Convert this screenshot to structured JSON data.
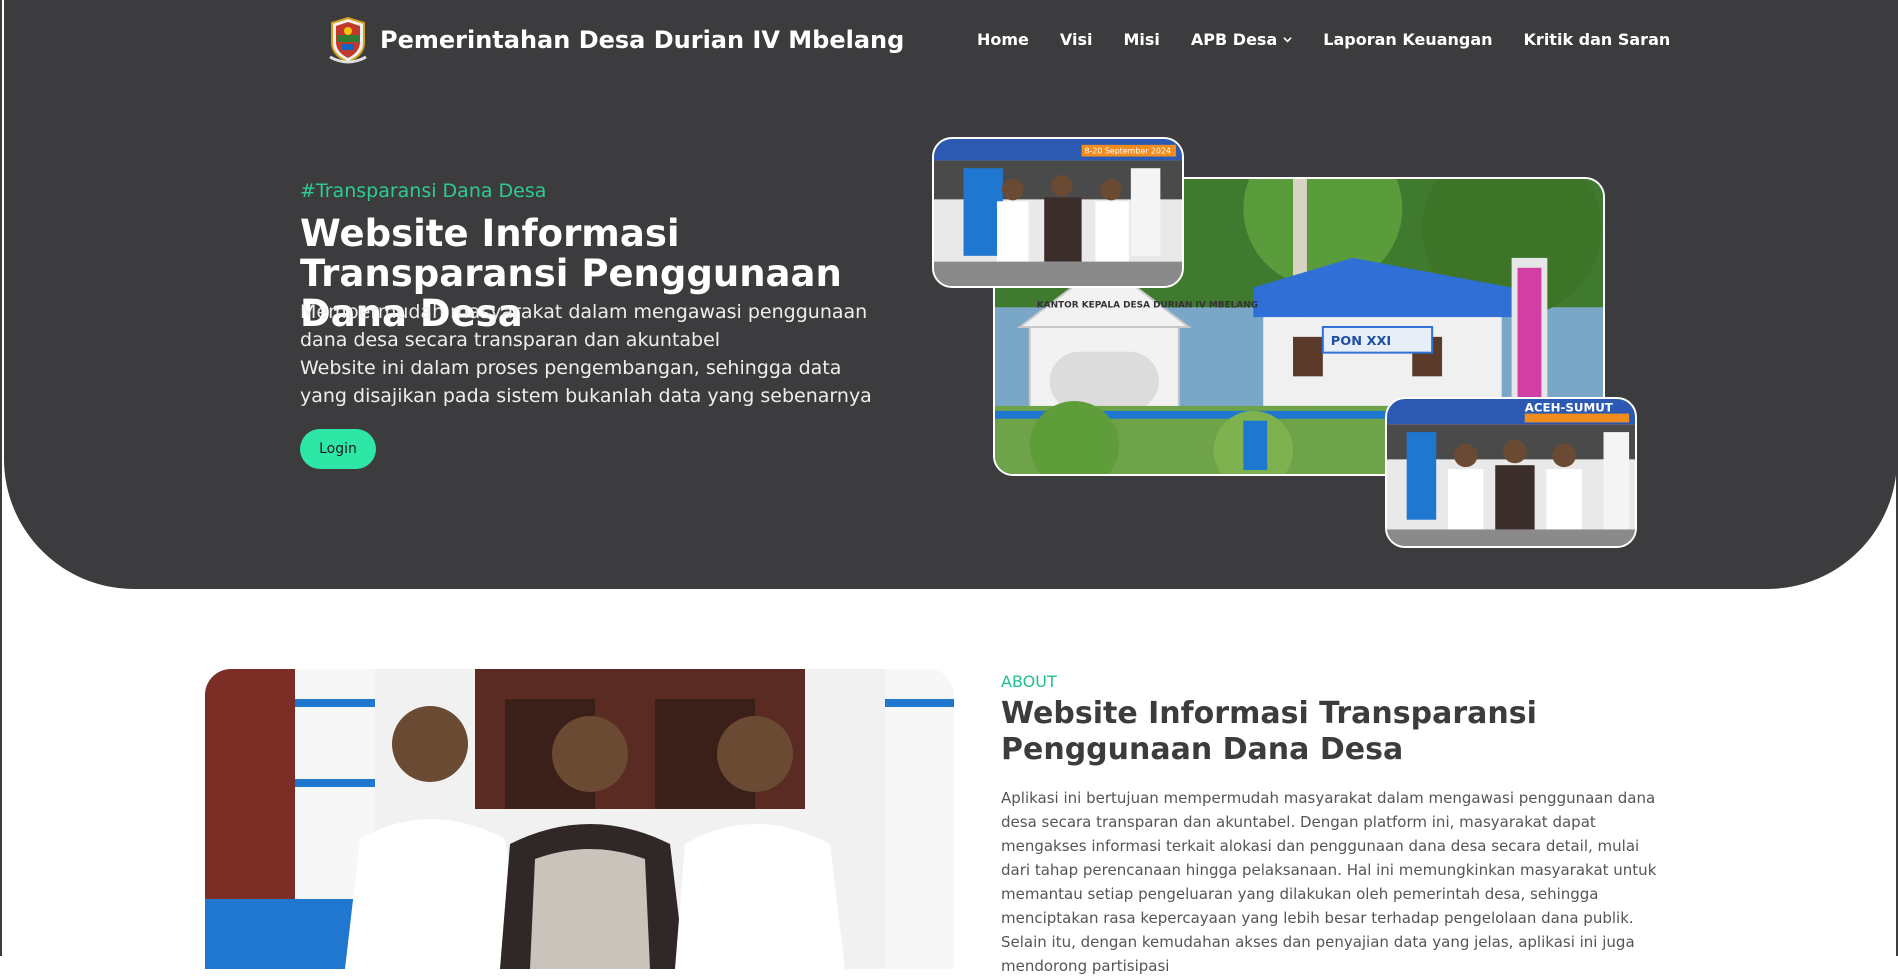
{
  "header": {
    "brand_name": "Pemerintahan Desa Durian IV Mbelang",
    "logo_icon": "village-crest-logo",
    "nav": [
      {
        "label": "Home"
      },
      {
        "label": "Visi"
      },
      {
        "label": "Misi"
      },
      {
        "label": "APB Desa",
        "has_dropdown": true
      },
      {
        "label": "Laporan Keuangan"
      },
      {
        "label": "Kritik dan Saran"
      }
    ]
  },
  "hero": {
    "hashtag": "#Transparansi Dana Desa",
    "title": "Website Informasi Transparansi Penggunaan Dana Desa",
    "description_1": "Mempermudah masyarakat dalam mengawasi penggunaan dana desa secara transparan dan akuntabel",
    "description_2": "Website ini dalam proses pengembangan, sehingga data yang disajikan pada sistem bukanlah data yang sebenarnya",
    "login_label": "Login",
    "photos": {
      "office_sign_text": "KANTOR KEPALA DESA DURIAN IV MBELANG",
      "banner_text": "PON XXI",
      "event_banner": "ACEH-SUMUT",
      "event_date": "8-20 September 2024"
    }
  },
  "about": {
    "label": "ABOUT",
    "title": "Website Informasi Transparansi Penggunaan Dana Desa",
    "body": "Aplikasi ini bertujuan mempermudah masyarakat dalam mengawasi penggunaan dana desa secara transparan dan akuntabel. Dengan platform ini, masyarakat dapat mengakses informasi terkait alokasi dan penggunaan dana desa secara detail, mulai dari tahap perencanaan hingga pelaksanaan. Hal ini memungkinkan masyarakat untuk memantau setiap pengeluaran yang dilakukan oleh pemerintah desa, sehingga menciptakan rasa kepercayaan yang lebih besar terhadap pengelolaan dana publik. Selain itu, dengan kemudahan akses dan penyajian data yang jelas, aplikasi ini juga mendorong partisipasi"
  },
  "colors": {
    "hero_bg": "#3c3c3e",
    "accent": "#2ee6a5",
    "accent_text": "#2ecc8f"
  }
}
